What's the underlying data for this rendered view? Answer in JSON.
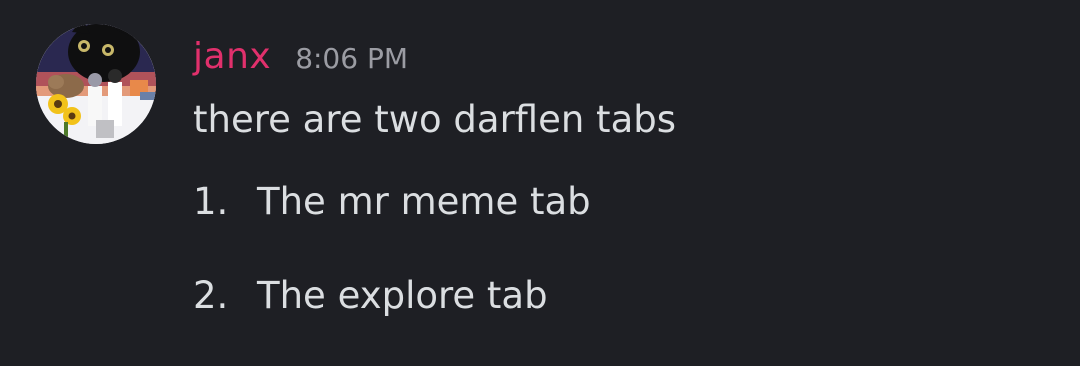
{
  "message": {
    "author": {
      "name": "janx",
      "name_color": "#e1306c"
    },
    "timestamp": "8:06 PM",
    "text": "there are two darflen tabs",
    "list": [
      {
        "marker": "1.",
        "text": "The mr meme tab"
      },
      {
        "marker": "2.",
        "text": "The explore tab"
      }
    ]
  },
  "colors": {
    "background": "#1e1f24",
    "text": "#dbdee1",
    "timestamp": "#9b9ca3"
  }
}
